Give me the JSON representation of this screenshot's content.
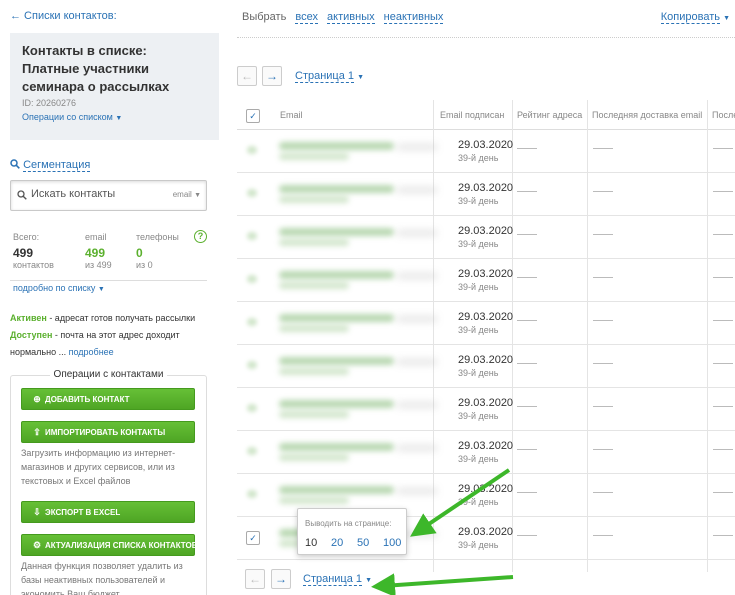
{
  "sidebar": {
    "back_link": "← Списки контактов:",
    "list_title": "Контакты в списке: Платные участники семинара о рассылках",
    "list_id": "ID: 20260276",
    "list_ops": "Операции со списком",
    "segmentation": "Сегментация",
    "search": {
      "placeholder": "Искать контакты",
      "field_select": "email"
    },
    "stats": {
      "total_label": "Всего:",
      "total_value": "499",
      "total_sub": "контактов",
      "email_label": "email",
      "email_value": "499",
      "email_sub": "из 499",
      "phone_label": "телефоны",
      "phone_value": "0",
      "phone_sub": "из 0",
      "help": "?"
    },
    "more_link": "подробно по списку",
    "legend": {
      "active_word": "Активен",
      "active_text": " - адресат готов получать рассылки",
      "available_word": "Доступен",
      "available_text": " - почта на этот адрес доходит",
      "normal_text": "нормально ... ",
      "details_link": "подробнее"
    },
    "ops": {
      "title": "Операции с контактами",
      "add_contact": "Добавить контакт",
      "import_contacts": "Импортировать контакты",
      "import_desc": "Загрузить информацию из интернет-магазинов и других сервисов, или из текстовых и Excel файлов",
      "export_excel": "Экспорт в Excel",
      "actualize": "Актуализация списка контактов",
      "actualize_desc": "Данная функция позволяет удалить из базы неактивных пользователей и экономить Ваш бюджет"
    }
  },
  "main": {
    "select_label": "Выбрать",
    "select_all": "всех",
    "select_active": "активных",
    "select_inactive": "неактивных",
    "copy": "Копировать",
    "page_label": "Страница 1",
    "table": {
      "headers": [
        "Email",
        "Email подписан",
        "Рейтинг адреса",
        "Последняя доставка email",
        "После"
      ],
      "rows": [
        {
          "date": "29.03.2020",
          "day": "39-й день"
        },
        {
          "date": "29.03.2020",
          "day": "39-й день"
        },
        {
          "date": "29.03.2020",
          "day": "39-й день"
        },
        {
          "date": "29.03.2020",
          "day": "39-й день"
        },
        {
          "date": "29.03.2020",
          "day": "39-й день"
        },
        {
          "date": "29.03.2020",
          "day": "39-й день"
        },
        {
          "date": "29.03.2020",
          "day": "39-й день"
        },
        {
          "date": "29.03.2020",
          "day": "39-й день"
        },
        {
          "date": "29.03.2020",
          "day": "39-й день"
        },
        {
          "date": "29.03.2020",
          "day": "39-й день"
        }
      ]
    },
    "per_page": {
      "title": "Выводить на странице:",
      "options": [
        "10",
        "20",
        "50",
        "100"
      ],
      "selected": "10"
    }
  },
  "colors": {
    "link": "#2a72b5",
    "green": "#5bb02e",
    "arrow": "#3db72a"
  }
}
